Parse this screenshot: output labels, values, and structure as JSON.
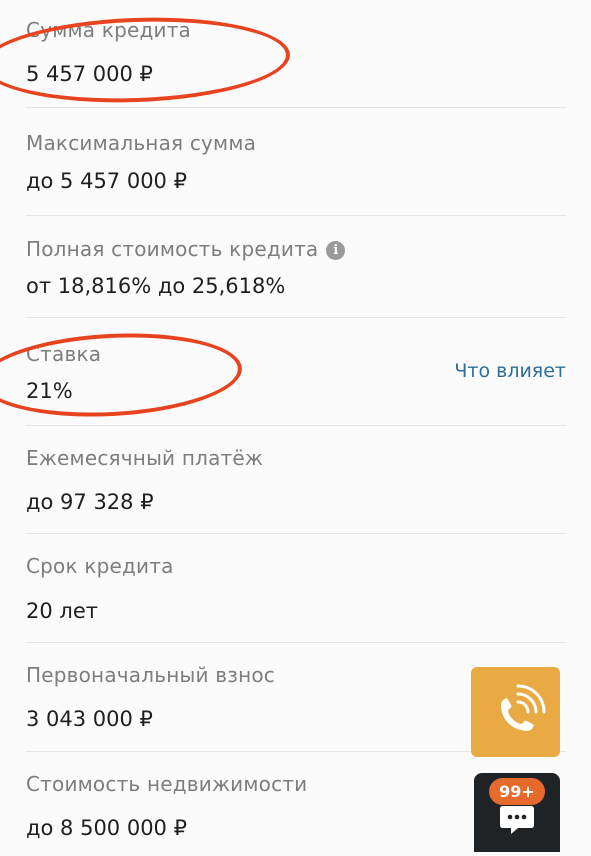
{
  "rows": [
    {
      "label": "Сумма кредита",
      "value": "5 457 000 ₽"
    },
    {
      "label": "Максимальная сумма",
      "value": "до 5 457 000 ₽"
    },
    {
      "label": "Полная стоимость кредита",
      "value": "от 18,816% до 25,618%",
      "icon": "info-icon"
    },
    {
      "label": "Ставка",
      "value": "21%",
      "link": "Что влияет"
    },
    {
      "label": "Ежемесячный платёж",
      "value": "до 97 328 ₽"
    },
    {
      "label": "Срок кредита",
      "value": "20 лет"
    },
    {
      "label": "Первоначальный взнос",
      "value": "3 043 000 ₽"
    },
    {
      "label": "Стоимость недвижимости",
      "value": "до 8 500 000 ₽"
    }
  ],
  "floating": {
    "call_icon": "phone-ringing-icon",
    "chat_icon": "chat-bubble-icon",
    "chat_badge": "99+"
  },
  "colors": {
    "highlight": "#e8431f",
    "call_button": "#e9aa44",
    "link": "#2c6d99",
    "badge": "#e56a2c"
  }
}
